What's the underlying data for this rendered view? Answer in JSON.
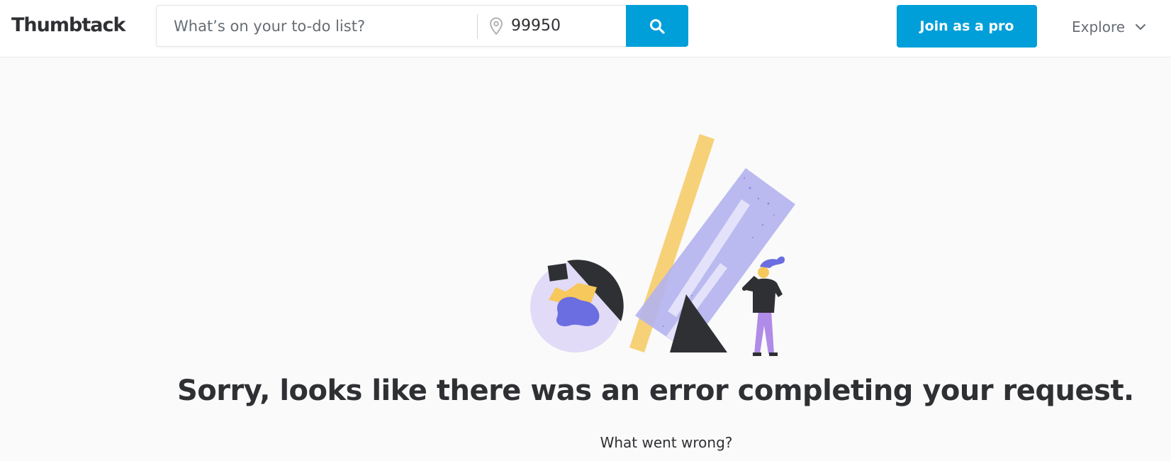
{
  "header": {
    "logo_text": "Thumbtack",
    "search": {
      "placeholder": "What’s on your to-do list?",
      "zip_value": "99950"
    },
    "join_button_label": "Join as a pro",
    "explore_label": "Explore"
  },
  "main": {
    "error_title": "Sorry, looks like there was an error completing your request.",
    "error_subtitle": "What went wrong?"
  },
  "colors": {
    "brand_blue": "#009fd9",
    "text_dark": "#2f3033",
    "illustration_yellow": "#f7c85b",
    "illustration_lavender": "#b3b3ee",
    "illustration_purple": "#6b6ee0"
  }
}
